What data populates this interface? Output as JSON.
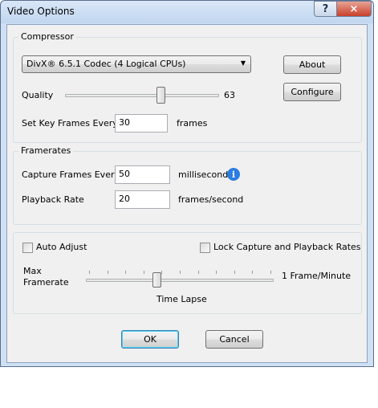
{
  "window": {
    "title": "Video Options",
    "help_label": "?",
    "close_label": "×"
  },
  "compressor": {
    "group_label": "Compressor",
    "codec": "DivX® 6.5.1 Codec (4 Logical CPUs)",
    "about_label": "About",
    "configure_label": "Configure",
    "quality_label": "Quality",
    "quality_value": "63",
    "quality_fraction": 0.63,
    "keyframes_label": "Set Key Frames Every",
    "keyframes_value": "30",
    "keyframes_unit": "frames"
  },
  "framerates": {
    "group_label": "Framerates",
    "capture_label": "Capture Frames Every",
    "capture_value": "50",
    "capture_unit": "milliseconds",
    "playback_label": "Playback Rate",
    "playback_value": "20",
    "playback_unit": "frames/second"
  },
  "timelapse": {
    "auto_adjust_label": "Auto Adjust",
    "lock_label": "Lock Capture and Playback Rates",
    "max_label_line1": "Max",
    "max_label_line2": "Framerate",
    "rate_value": "1 Frame/Minute",
    "slider_caption": "Time Lapse",
    "slider_fraction": 0.37,
    "tick_count": 11
  },
  "buttons": {
    "ok_label": "OK",
    "cancel_label": "Cancel"
  },
  "icons": {
    "info": "info-icon",
    "dropdown": "chevron-down-icon"
  }
}
